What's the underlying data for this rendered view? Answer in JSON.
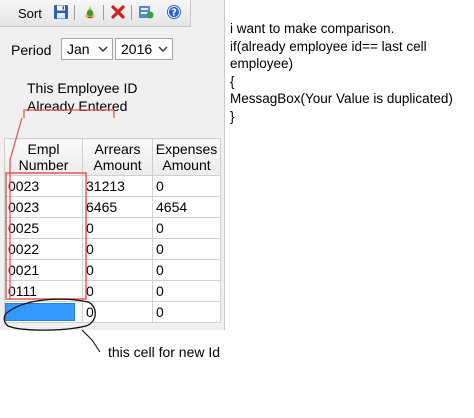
{
  "toolbar": {
    "sort_label": "Sort",
    "icons": [
      "save-icon",
      "refresh-icon",
      "delete-icon",
      "export-icon",
      "help-icon"
    ]
  },
  "period": {
    "label": "Period",
    "month": "Jan",
    "year": "2016"
  },
  "grid": {
    "headers": [
      {
        "line1": "Empl",
        "line2": "Number"
      },
      {
        "line1": "Arrears",
        "line2": "Amount"
      },
      {
        "line1": "Expenses",
        "line2": "Amount"
      }
    ],
    "rows": [
      [
        "0023",
        "31213",
        "0"
      ],
      [
        "0023",
        "6465",
        "4654"
      ],
      [
        "0025",
        "0",
        "0"
      ],
      [
        "0022",
        "0",
        "0"
      ],
      [
        "0021",
        "0",
        "0"
      ],
      [
        "0111",
        "0",
        "0"
      ]
    ],
    "new_row": [
      "",
      "0",
      "0"
    ]
  },
  "annotations": {
    "top_note_line1": "This Employee ID",
    "top_note_line2": "Already Entered",
    "bottom_note": "this cell for new Id",
    "code_lines": [
      "i want to make comparison.",
      "if(already employee id== last cell",
      "employee)",
      "{",
      "MessagBox(Your Value is duplicated)",
      "}"
    ]
  },
  "colors": {
    "annotation_red": "#e05a5a",
    "selection_blue": "#3399ff"
  }
}
